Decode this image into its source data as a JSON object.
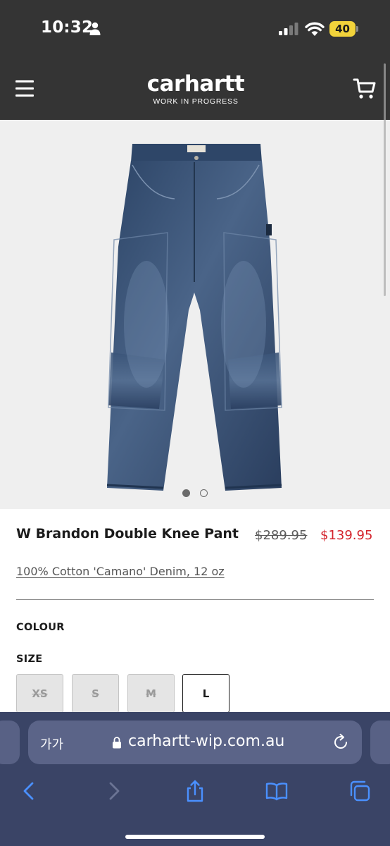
{
  "status_bar": {
    "time": "10:32",
    "battery": "40"
  },
  "site": {
    "logo_word": "carhartt",
    "logo_sub": "WORK IN PROGRESS"
  },
  "product": {
    "name": "W Brandon Double Knee Pant",
    "price_old": "$289.95",
    "price_new": "$139.95",
    "material": "100% Cotton 'Camano' Denim, 12 oz",
    "colour_label": "COLOUR",
    "size_label": "SIZE",
    "sizes": [
      {
        "label": "XS",
        "available": false
      },
      {
        "label": "S",
        "available": false
      },
      {
        "label": "M",
        "available": false
      },
      {
        "label": "L",
        "available": true
      }
    ],
    "image_count": 2,
    "active_image": 1
  },
  "browser": {
    "text_size_label": "가가",
    "url": "carhartt-wip.com.au"
  },
  "colors": {
    "header_bg": "#343434",
    "sale_price": "#d4232c",
    "safari_bg": "#3a4466",
    "toolbar_icons": "#4a90ff"
  }
}
